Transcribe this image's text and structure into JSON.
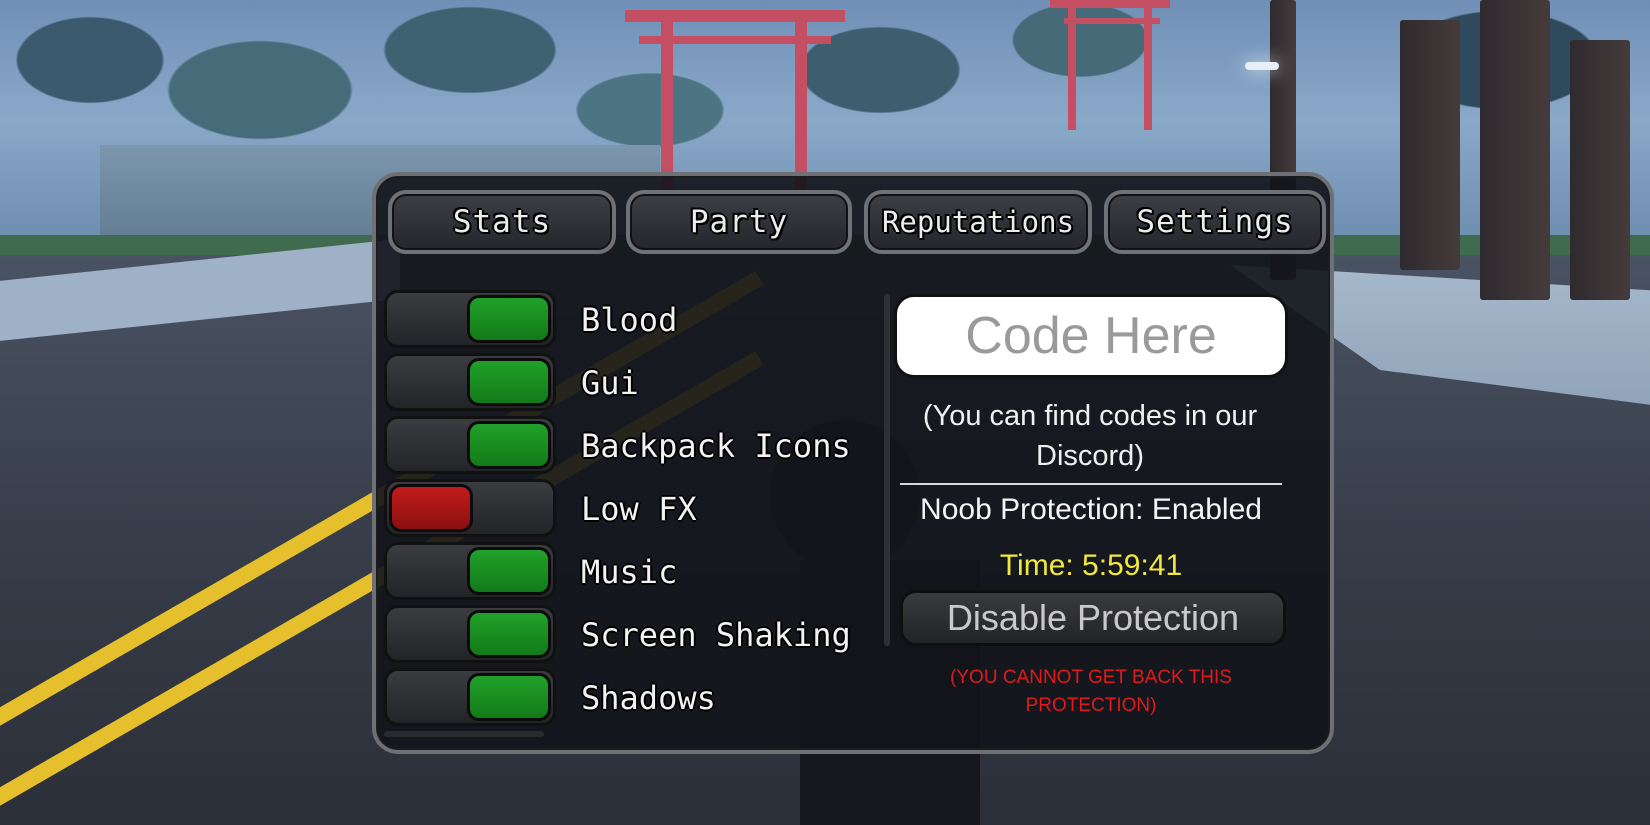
{
  "tabs": {
    "stats": "Stats",
    "party": "Party",
    "reputations": "Reputations",
    "settings": "Settings"
  },
  "toggles": [
    {
      "label": "Blood",
      "state": "on"
    },
    {
      "label": "Gui",
      "state": "on"
    },
    {
      "label": "Backpack Icons",
      "state": "on"
    },
    {
      "label": "Low FX",
      "state": "off"
    },
    {
      "label": "Music",
      "state": "on"
    },
    {
      "label": "Screen Shaking",
      "state": "on"
    },
    {
      "label": "Shadows",
      "state": "on"
    }
  ],
  "code": {
    "placeholder": "Code Here",
    "value": ""
  },
  "hint": "(You can find codes in our Discord)",
  "protection": {
    "status": "Noob Protection: Enabled",
    "timer": "Time: 5:59:41",
    "button": "Disable Protection",
    "warning": "(YOU CANNOT GET BACK THIS PROTECTION)"
  },
  "colors": {
    "toggle_on": "#1e9a27",
    "toggle_off": "#b51818",
    "timer": "#f2e83a",
    "warning": "#e01b1b"
  }
}
